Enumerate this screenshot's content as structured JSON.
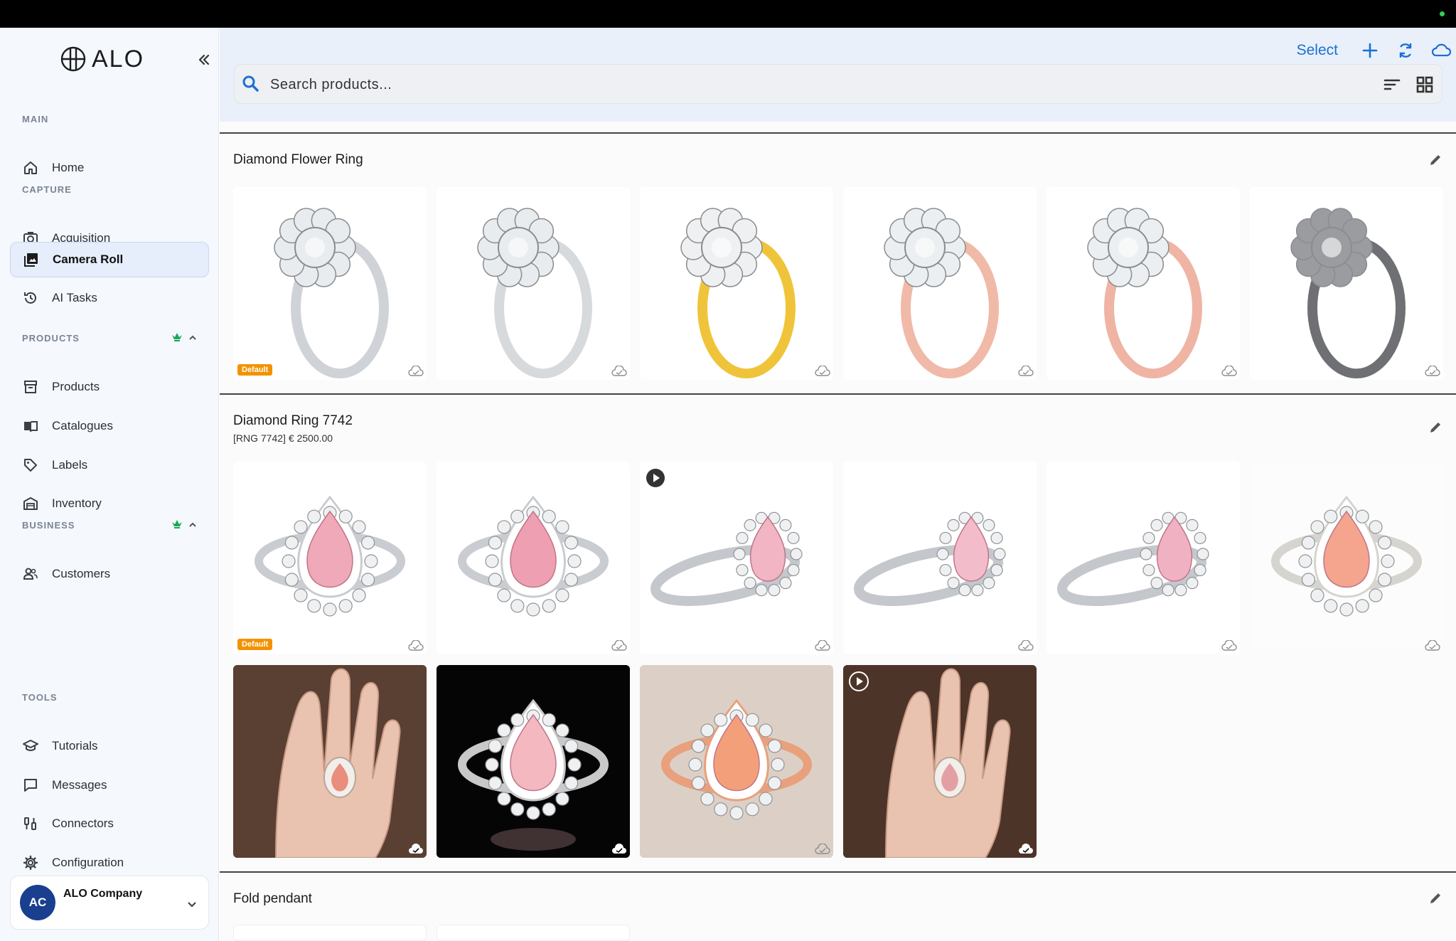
{
  "app": {
    "logo_text": "ALO"
  },
  "sidebar": {
    "sections": {
      "main": "MAIN",
      "capture": "CAPTURE",
      "products": "PRODUCTS",
      "business": "BUSINESS",
      "tools": "TOOLS"
    },
    "items": {
      "home": "Home",
      "acquisition": "Acquisition",
      "camera_roll": "Camera Roll",
      "ai_tasks": "AI Tasks",
      "products": "Products",
      "catalogues": "Catalogues",
      "labels": "Labels",
      "inventory": "Inventory",
      "customers": "Customers",
      "tutorials": "Tutorials",
      "messages": "Messages",
      "connectors": "Connectors",
      "configuration": "Configuration"
    },
    "account": {
      "initials": "AC",
      "name": "ALO Company"
    }
  },
  "header": {
    "select_label": "Select",
    "search_placeholder": "Search products..."
  },
  "products": [
    {
      "title": "Diamond Flower Ring",
      "subtitle": "",
      "badge": "Default"
    },
    {
      "title": "Diamond Ring 7742",
      "subtitle": "[RNG 7742]  € 2500.00",
      "badge": "Default"
    },
    {
      "title": "Fold pendant",
      "subtitle": ""
    }
  ],
  "colors": {
    "accent": "#1c6fd6",
    "badge": "#f39200",
    "crown": "#1aa65b",
    "avatar": "#1a3f8f"
  }
}
